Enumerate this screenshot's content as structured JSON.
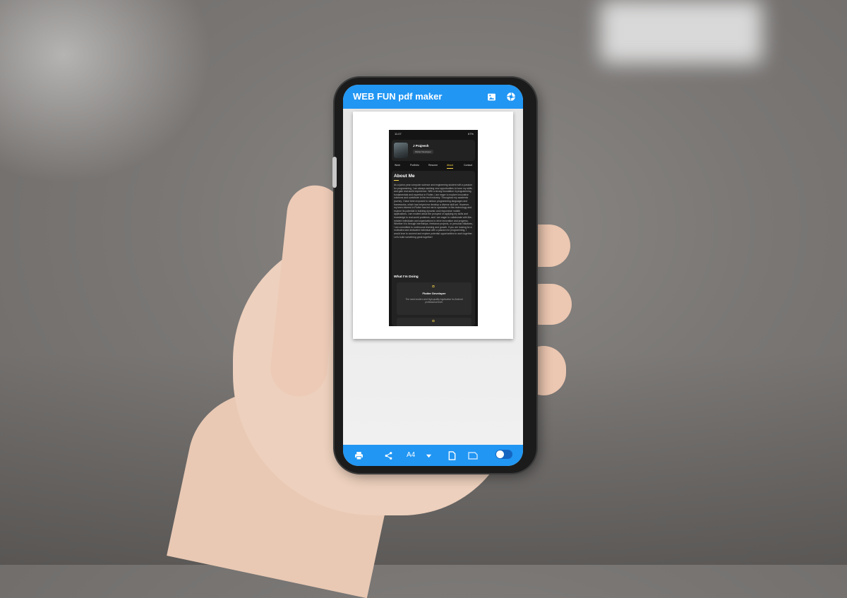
{
  "app": {
    "title": "WEB FUN pdf maker",
    "colors": {
      "primary": "#2196f3",
      "on_primary": "#ffffff"
    },
    "icons": {
      "image": "image-icon",
      "settings": "aperture-icon"
    }
  },
  "bottom_bar": {
    "page_size": "A4",
    "icons": [
      "print-icon",
      "share-icon",
      "dropdown-icon",
      "portrait-icon",
      "landscape-icon",
      "toggle"
    ]
  },
  "preview": {
    "status_bar": {
      "time": "11:07",
      "right": "67%"
    },
    "profile": {
      "name": "J Prajeesh",
      "role": "Flutter Developer"
    },
    "nav": [
      "Work",
      "Portfolio",
      "Resume",
      "About",
      "Contact"
    ],
    "active_nav": "About",
    "about_title": "About Me",
    "about_text": "As a junior-year computer science and engineering student with a passion for programming, I am always seeking new opportunities to hone my skills and gain real-world experience. With a strong foundation in programming fundamentals and expertise in Flutter, I am eager to explore innovative solutions and contribute to the tech industry. Throughout my academic journey, I have been exposed to various programming languages and frameworks, which has helped me develop a diverse skill set. However, my keen interest in Flutter has led me to specialize in this technology and explore its potential in building dynamic and responsive mobile applications. I am excited about the prospect of applying my skills and knowledge to real-world problems, and I am eager to collaborate with like-minded individuals and organizations to drive innovation and progress. Whether it is through internships, freelance projects, or personal initiatives, I am committed to continuous learning and growth. If you are looking for a motivated and dedicated individual with a passion for programming, I would love to connect and explore potential opportunities to work together. Let's build something great together!",
    "doing_title": "What I'm Doing",
    "service": {
      "icon": "¤",
      "title": "Flutter Developer",
      "desc": "The most modern and high-quality Application for Android professional level."
    }
  }
}
